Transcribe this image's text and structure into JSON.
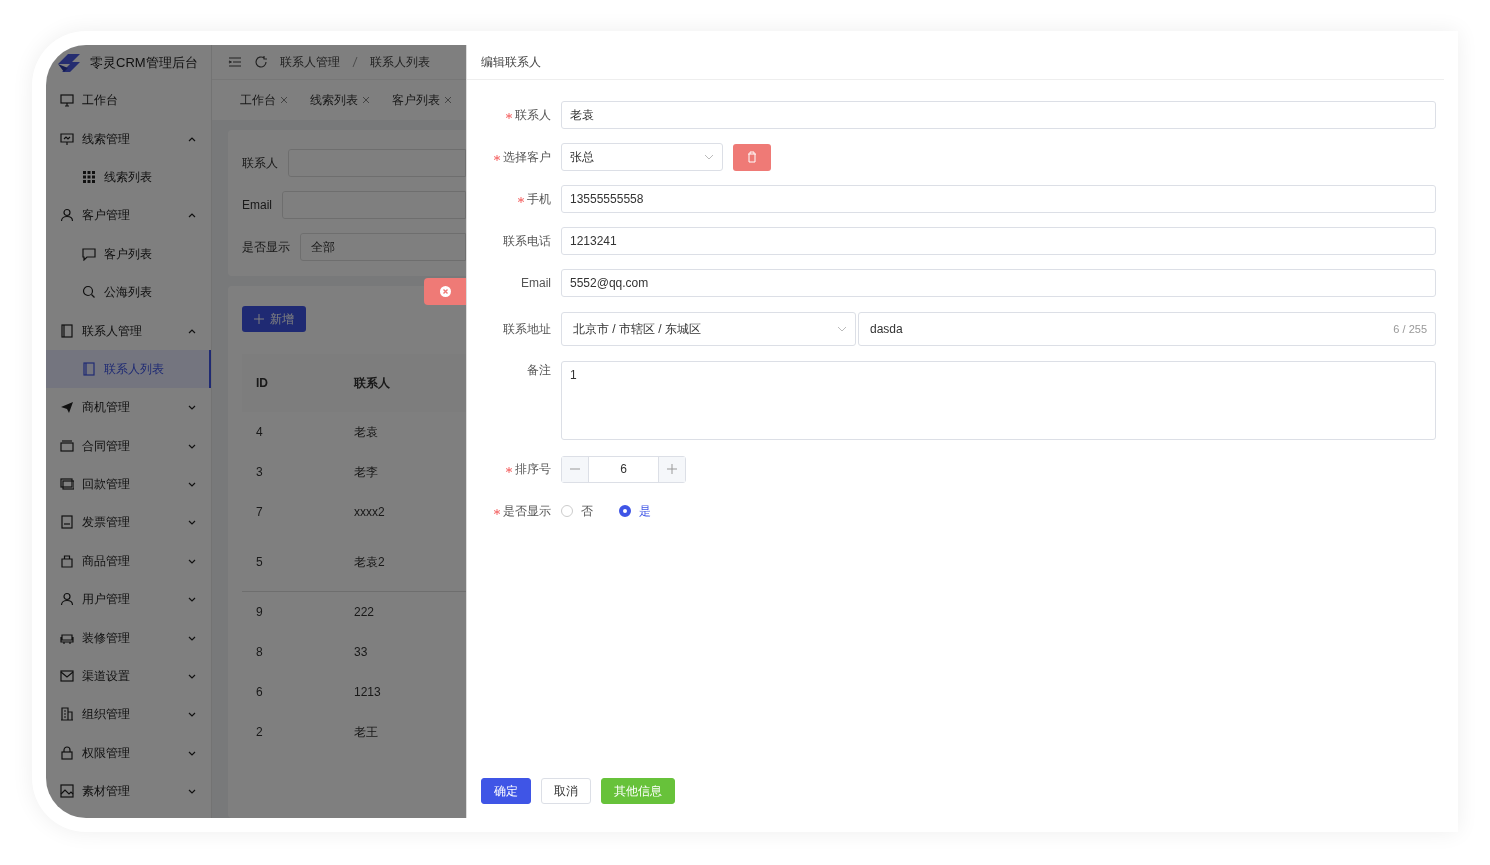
{
  "app": {
    "title": "零灵CRM管理后台"
  },
  "breadcrumb": [
    "联系人管理",
    "联系人列表"
  ],
  "tabs": [
    {
      "label": "工作台"
    },
    {
      "label": "线索列表"
    },
    {
      "label": "客户列表"
    }
  ],
  "sidebar": {
    "items": [
      {
        "label": "工作台"
      },
      {
        "label": "线索管理",
        "expanded": true,
        "children": [
          {
            "label": "线索列表",
            "selected": false
          }
        ]
      },
      {
        "label": "客户管理",
        "expanded": true,
        "children": [
          {
            "label": "客户列表",
            "selected": false
          },
          {
            "label": "公海列表",
            "selected": false
          }
        ]
      },
      {
        "label": "联系人管理",
        "expanded": true,
        "children": [
          {
            "label": "联系人列表",
            "selected": true
          }
        ]
      },
      {
        "label": "商机管理",
        "expanded": false
      },
      {
        "label": "合同管理",
        "expanded": false
      },
      {
        "label": "回款管理",
        "expanded": false
      },
      {
        "label": "发票管理",
        "expanded": false
      },
      {
        "label": "商品管理",
        "expanded": false
      },
      {
        "label": "用户管理",
        "expanded": false
      },
      {
        "label": "装修管理",
        "expanded": false
      },
      {
        "label": "渠道设置",
        "expanded": false
      },
      {
        "label": "组织管理",
        "expanded": false
      },
      {
        "label": "权限管理",
        "expanded": false
      },
      {
        "label": "素材管理",
        "expanded": false
      }
    ]
  },
  "filters": [
    {
      "label": "联系人"
    },
    {
      "label": "Email"
    },
    {
      "label": "是否显示",
      "value": "全部"
    }
  ],
  "add_button": "新增",
  "table": {
    "columns": [
      "ID",
      "联系人"
    ],
    "rows": [
      [
        "4",
        "老袁"
      ],
      [
        "3",
        "老李"
      ],
      [
        "7",
        "xxxx2"
      ],
      [
        "5",
        "老袁2"
      ],
      [
        "9",
        "222"
      ],
      [
        "8",
        "33"
      ],
      [
        "6",
        "1213"
      ],
      [
        "2",
        "老王"
      ]
    ]
  },
  "drawer": {
    "title": "编辑联系人",
    "fields": [
      {
        "kind": "text",
        "label": "联系人",
        "required": true,
        "value": "老袁"
      },
      {
        "kind": "select",
        "label": "选择客户",
        "required": true,
        "value": "张总"
      },
      {
        "kind": "text",
        "label": "手机",
        "required": true,
        "value": "13555555558"
      },
      {
        "kind": "text",
        "label": "联系电话",
        "required": false,
        "value": "1213241"
      },
      {
        "kind": "text",
        "label": "Email",
        "required": false,
        "value": "5552@qq.com"
      },
      {
        "kind": "address",
        "label": "联系地址",
        "required": false,
        "value": "北京市 / 市辖区 / 东城区",
        "detail": "dasda",
        "counter": "6 / 255"
      },
      {
        "kind": "textarea",
        "label": "备注",
        "required": false,
        "value": "1"
      },
      {
        "kind": "number",
        "label": "排序号",
        "required": true,
        "value": "6"
      },
      {
        "kind": "radio",
        "label": "是否显示",
        "required": true,
        "options": [
          {
            "label": "否",
            "selected": false
          },
          {
            "label": "是",
            "selected": true
          }
        ]
      }
    ],
    "buttons": [
      {
        "label": "确定",
        "kind": "primary"
      },
      {
        "label": "取消",
        "kind": "default"
      },
      {
        "label": "其他信息",
        "kind": "success"
      }
    ]
  }
}
